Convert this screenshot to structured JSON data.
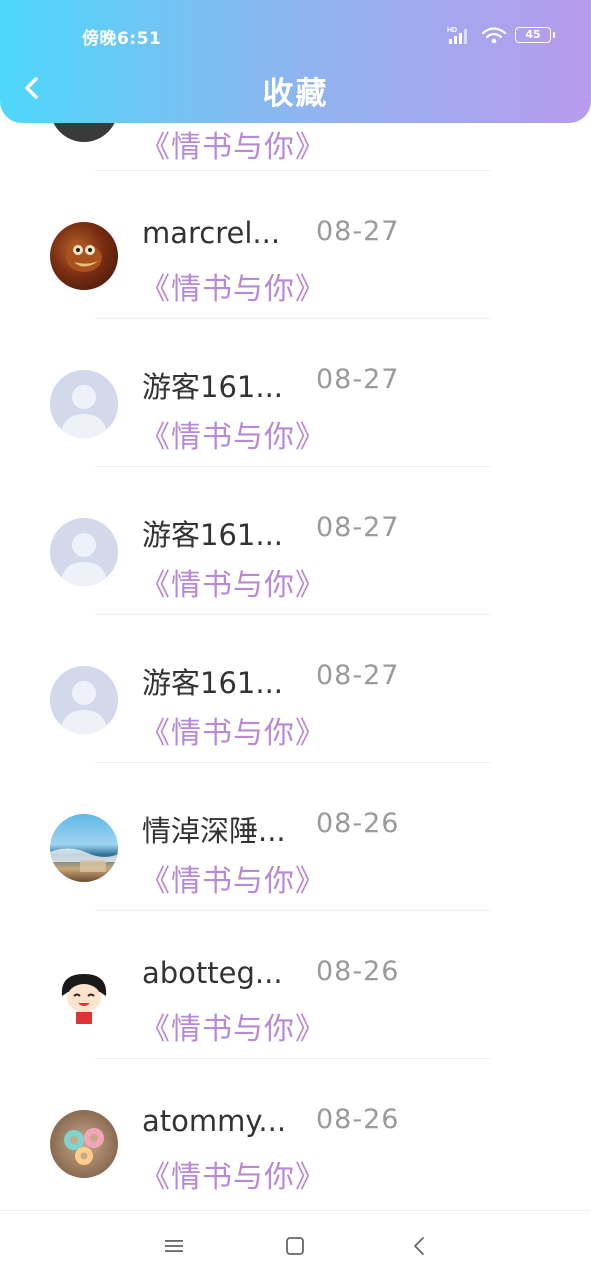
{
  "status_bar": {
    "time": "傍晚6:51",
    "battery": "45",
    "network_label": "HD"
  },
  "header": {
    "title": "收藏"
  },
  "items": [
    {
      "name": "",
      "date": "",
      "title": "《情书与你》",
      "avatar": "avatar-partial-dark"
    },
    {
      "name": "marcrel...",
      "date": "08-27",
      "title": "《情书与你》",
      "avatar": "avatar-cartoon-bird"
    },
    {
      "name": "游客161...",
      "date": "08-27",
      "title": "《情书与你》",
      "avatar": "avatar-default-person"
    },
    {
      "name": "游客161...",
      "date": "08-27",
      "title": "《情书与你》",
      "avatar": "avatar-default-person"
    },
    {
      "name": "游客161...",
      "date": "08-27",
      "title": "《情书与你》",
      "avatar": "avatar-default-person"
    },
    {
      "name": "情淖深陲...",
      "date": "08-26",
      "title": "《情书与你》",
      "avatar": "avatar-seascape"
    },
    {
      "name": "abotteg...",
      "date": "08-26",
      "title": "《情书与你》",
      "avatar": "avatar-cartoon-girl"
    },
    {
      "name": "atommy...",
      "date": "08-26",
      "title": "《情书与你》",
      "avatar": "avatar-donuts"
    }
  ],
  "bottom_nav": {
    "menu_icon": "menu-icon",
    "home_icon": "home-square-icon",
    "back_icon": "back-triangle-icon"
  },
  "colors": {
    "header_gradient_start": "#4dd7fb",
    "header_gradient_end": "#b89bec",
    "title_purple": "#b889d8",
    "date_gray": "#9a9a9a"
  }
}
